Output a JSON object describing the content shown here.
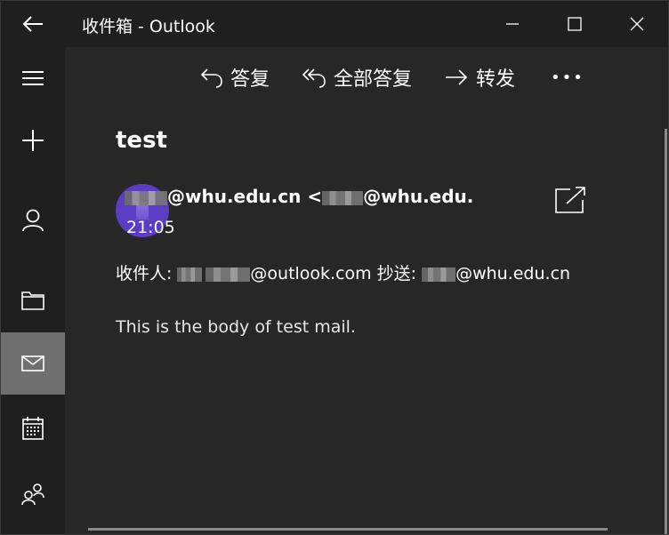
{
  "window": {
    "title": "收件箱 - Outlook"
  },
  "toolbar": {
    "reply_label": "答复",
    "reply_all_label": "全部答复",
    "forward_label": "转发",
    "more_label": "•••"
  },
  "rail": {
    "items": [
      {
        "icon": "hamburger-menu-icon"
      },
      {
        "icon": "compose-plus-icon"
      },
      {
        "icon": "person-icon"
      },
      {
        "icon": "folder-icon"
      },
      {
        "icon": "mail-icon",
        "selected": true
      },
      {
        "icon": "calendar-icon"
      },
      {
        "icon": "people-icon"
      }
    ]
  },
  "message": {
    "subject": "test",
    "sender_domain": "@whu.edu.cn",
    "sender_separator": " <",
    "sender_address_domain": "@whu.edu.cn>",
    "time": "21:05",
    "to_label": "收件人:",
    "to_domain": "@outlook.com",
    "cc_label": "抄送:",
    "cc_domain": "@whu.edu.cn",
    "body": "This is the body of test mail."
  },
  "colors": {
    "background": "#272727",
    "chrome": "#1f1f1f",
    "selected_rail": "#6f6f6f",
    "avatar": "#5b3dc4"
  }
}
